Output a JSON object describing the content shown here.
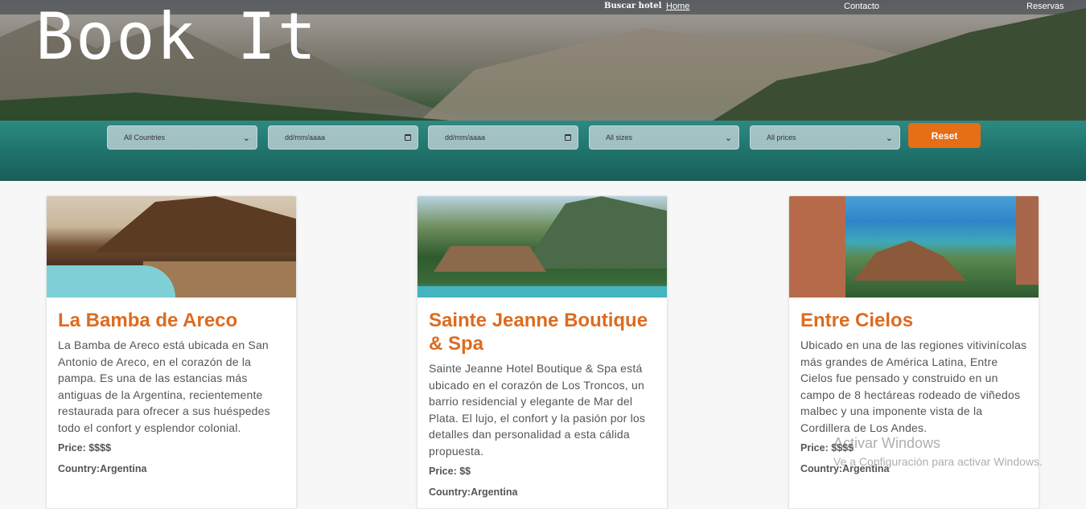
{
  "nav": {
    "search_label": "Buscar hotel",
    "home_label": "Home",
    "contact_label": "Contacto",
    "bookings_label": "Reservas"
  },
  "brand": {
    "logo_text": "Book It"
  },
  "filters": {
    "country": "All Countries",
    "date_from": "dd/mm/aaaa",
    "date_to": "dd/mm/aaaa",
    "size": "All sizes",
    "price": "All prices",
    "reset_label": "Reset"
  },
  "hotels": [
    {
      "name": "La Bamba de Areco",
      "description": "La Bamba de Areco está ubicada en San Antonio de Areco, en el corazón de la pampa. Es una de las estancias más antiguas de la Argentina, recientemente restaurada para ofrecer a sus huéspedes todo el confort y esplendor colonial.",
      "price": "Price: $$$$",
      "country": "Country:Argentina"
    },
    {
      "name": "Sainte Jeanne Boutique & Spa",
      "description": "Sainte Jeanne Hotel Boutique & Spa está ubicado en el corazón de Los Troncos, un barrio residencial y elegante de Mar del Plata. El lujo, el confort y la pasión por los detalles dan personalidad a esta cálida propuesta.",
      "price": "Price: $$",
      "country": "Country:Argentina"
    },
    {
      "name": "Entre Cielos",
      "description": "Ubicado en una de las regiones vitivinícolas más grandes de América Latina, Entre Cielos fue pensado y construido en un campo de 8 hectáreas rodeado de viñedos malbec y una imponente vista de la Cordillera de Los Andes.",
      "price": "Price: $$$$",
      "country": "Country:Argentina"
    }
  ],
  "watermark": {
    "title": "Activar Windows",
    "subtitle": "Ve a Configuración para activar Windows."
  }
}
